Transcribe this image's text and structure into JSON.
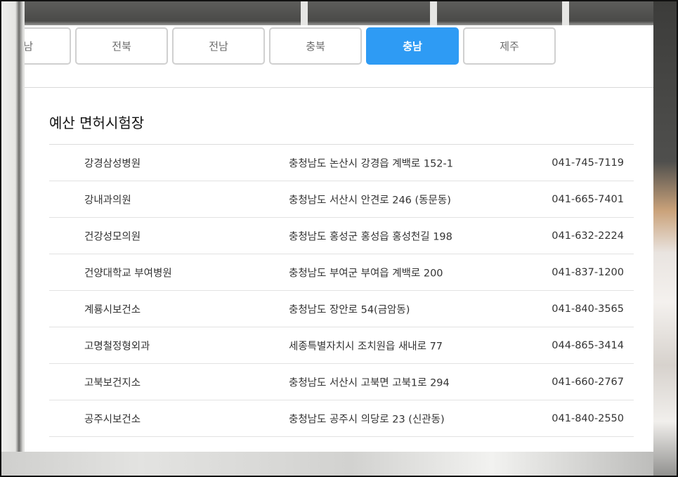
{
  "tabs": [
    {
      "label": "남",
      "active": false
    },
    {
      "label": "전북",
      "active": false
    },
    {
      "label": "전남",
      "active": false
    },
    {
      "label": "충북",
      "active": false
    },
    {
      "label": "충남",
      "active": true
    },
    {
      "label": "제주",
      "active": false
    }
  ],
  "section": {
    "title": "예산 면허시험장"
  },
  "hospitals": [
    {
      "name": "강경삼성병원",
      "address": "충청남도 논산시 강경읍 계백로 152-1",
      "phone": "041-745-7119"
    },
    {
      "name": "강내과의원",
      "address": "충청남도 서산시 안견로 246 (동문동)",
      "phone": "041-665-7401"
    },
    {
      "name": "건강성모의원",
      "address": "충청남도 홍성군 홍성읍 홍성천길 198",
      "phone": "041-632-2224"
    },
    {
      "name": "건양대학교 부여병원",
      "address": "충청남도 부여군 부여읍 계백로 200",
      "phone": "041-837-1200"
    },
    {
      "name": "계룡시보건소",
      "address": "충청남도 장안로 54(금암동)",
      "phone": "041-840-3565"
    },
    {
      "name": "고명철정형외과",
      "address": "세종특별자치시 조치원읍 새내로 77",
      "phone": "044-865-3414"
    },
    {
      "name": "고북보건지소",
      "address": "충청남도 서산시 고북면 고북1로 294",
      "phone": "041-660-2767"
    },
    {
      "name": "공주시보건소",
      "address": "충청남도 공주시 의당로 23 (신관동)",
      "phone": "041-840-2550"
    },
    {
      "name": "",
      "address": "",
      "phone": ""
    }
  ],
  "colors": {
    "accent": "#2e9bf4",
    "text": "#333333",
    "border": "#d0d0d0"
  }
}
